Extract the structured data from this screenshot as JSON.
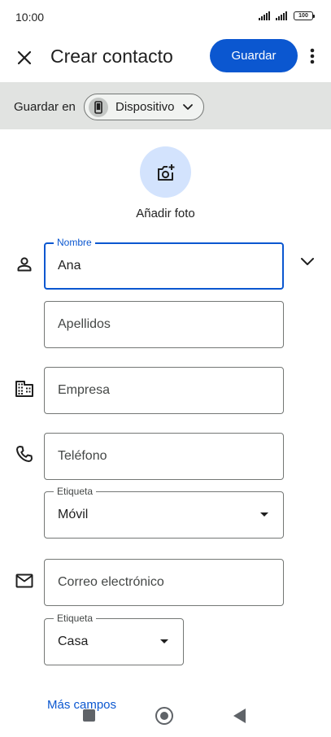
{
  "status_bar": {
    "time": "10:00",
    "battery": "100"
  },
  "app_bar": {
    "close_icon": "close-icon",
    "title": "Crear contacto",
    "save_label": "Guardar",
    "more_icon": "more-vert-icon",
    "accent_color": "#0b57d0"
  },
  "account": {
    "label": "Guardar en",
    "chip_label": "Dispositivo",
    "chip_icon": "phone-device-icon",
    "chevron_icon": "chevron-down-icon"
  },
  "photo": {
    "icon": "add-photo-icon",
    "label": "Añadir foto"
  },
  "form": {
    "nombre": {
      "label": "Nombre",
      "value": "Ana"
    },
    "apellidos": {
      "placeholder": "Apellidos"
    },
    "empresa": {
      "placeholder": "Empresa"
    },
    "telefono": {
      "placeholder": "Teléfono"
    },
    "telefono_etiqueta": {
      "label": "Etiqueta",
      "value": "Móvil"
    },
    "correo": {
      "placeholder": "Correo electrónico"
    },
    "correo_etiqueta": {
      "label": "Etiqueta",
      "value": "Casa"
    }
  },
  "more_fields": "Más campos",
  "nav": {
    "recents_icon": "recents-square-icon",
    "home_icon": "home-circle-icon",
    "back_icon": "back-triangle-icon"
  }
}
